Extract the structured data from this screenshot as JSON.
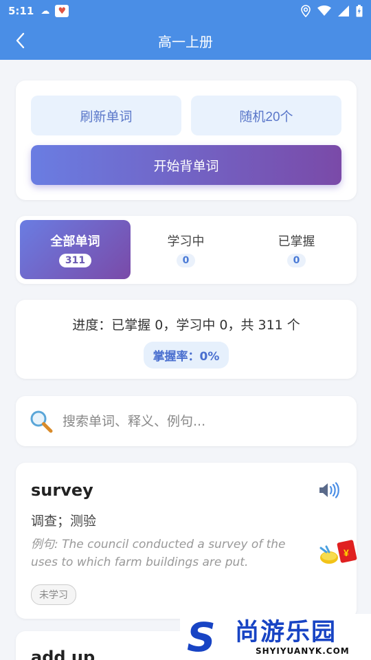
{
  "status_bar": {
    "time": "5:11"
  },
  "header": {
    "title": "高一上册"
  },
  "actions": {
    "refresh_label": "刷新单词",
    "random_label": "随机20个",
    "start_label": "开始背单词"
  },
  "tabs": [
    {
      "label": "全部单词",
      "count": "311",
      "active": true
    },
    {
      "label": "学习中",
      "count": "0",
      "active": false
    },
    {
      "label": "已掌握",
      "count": "0",
      "active": false
    }
  ],
  "progress": {
    "text": "进度：已掌握 0，学习中 0，共 311 个",
    "mastery_label": "掌握率：0%"
  },
  "search": {
    "placeholder": "搜索单词、释义、例句..."
  },
  "words": [
    {
      "word": "survey",
      "meaning": "调查；测验",
      "example_prefix": "例句",
      "example": ": The council conducted a survey of the uses to which farm buildings are put.",
      "status": "未学习"
    },
    {
      "word": "add up"
    }
  ],
  "watermark": {
    "mark": "S",
    "cn": "尚游乐园",
    "en": "SHYIYUANYK.COM"
  },
  "colors": {
    "primary": "#4a8ee6",
    "gradient_start": "#6a7de2",
    "gradient_end": "#7a4aa8",
    "accent_blue": "#4a6fcf"
  },
  "icons": [
    "back-arrow-icon",
    "search-icon",
    "speaker-icon",
    "wifi-icon",
    "signal-icon",
    "battery-icon",
    "location-icon"
  ]
}
